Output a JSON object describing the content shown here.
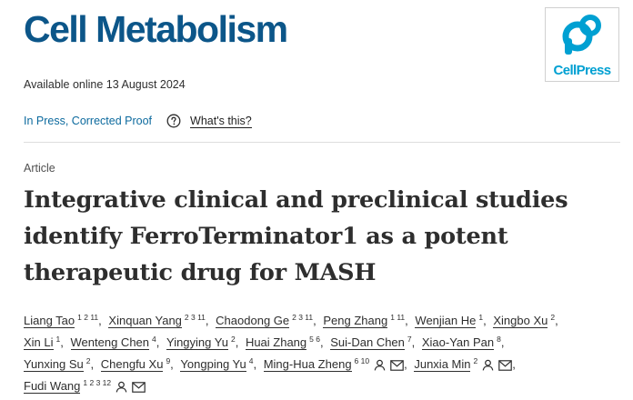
{
  "header": {
    "journal": "Cell Metabolism",
    "publisher": "CellPress",
    "available_online": "Available online 13 August 2024"
  },
  "status": {
    "in_press_label": "In Press, Corrected Proof",
    "help_icon": "question-circle-icon",
    "whats_this_label": "What's this?"
  },
  "article": {
    "type": "Article",
    "title_lines": [
      "Integrative clinical and preclinical studies",
      "identify FerroTerminator1 as a potent",
      "therapeutic drug for MASH"
    ]
  },
  "authors": [
    [
      {
        "name": "Liang Tao",
        "aff": "1 2 11"
      },
      {
        "name": "Xinquan Yang",
        "aff": "2 3 11"
      },
      {
        "name": "Chaodong Ge",
        "aff": "2 3 11"
      },
      {
        "name": "Peng Zhang",
        "aff": "1 11"
      },
      {
        "name": "Wenjian He",
        "aff": "1"
      },
      {
        "name": "Xingbo Xu",
        "aff": "2"
      }
    ],
    [
      {
        "name": "Xin Li",
        "aff": "1"
      },
      {
        "name": "Wenteng Chen",
        "aff": "4"
      },
      {
        "name": "Yingying Yu",
        "aff": "2"
      },
      {
        "name": "Huai Zhang",
        "aff": "5 6"
      },
      {
        "name": "Sui-Dan Chen",
        "aff": "7"
      },
      {
        "name": "Xiao-Yan Pan",
        "aff": "8"
      }
    ],
    [
      {
        "name": "Yunxing Su",
        "aff": "2"
      },
      {
        "name": "Chengfu Xu",
        "aff": "9"
      },
      {
        "name": "Yongping Yu",
        "aff": "4"
      },
      {
        "name": "Ming-Hua Zheng",
        "aff": "6 10",
        "icons": true
      },
      {
        "name": "Junxia Min",
        "aff": "2",
        "icons": true
      }
    ],
    [
      {
        "name": "Fudi Wang",
        "aff": "1 2 3 12",
        "icons": true
      }
    ]
  ],
  "colors": {
    "journal_blue": "#0c5689",
    "link_blue": "#0c6a9e",
    "cellpress_blue": "#00a0d2"
  }
}
